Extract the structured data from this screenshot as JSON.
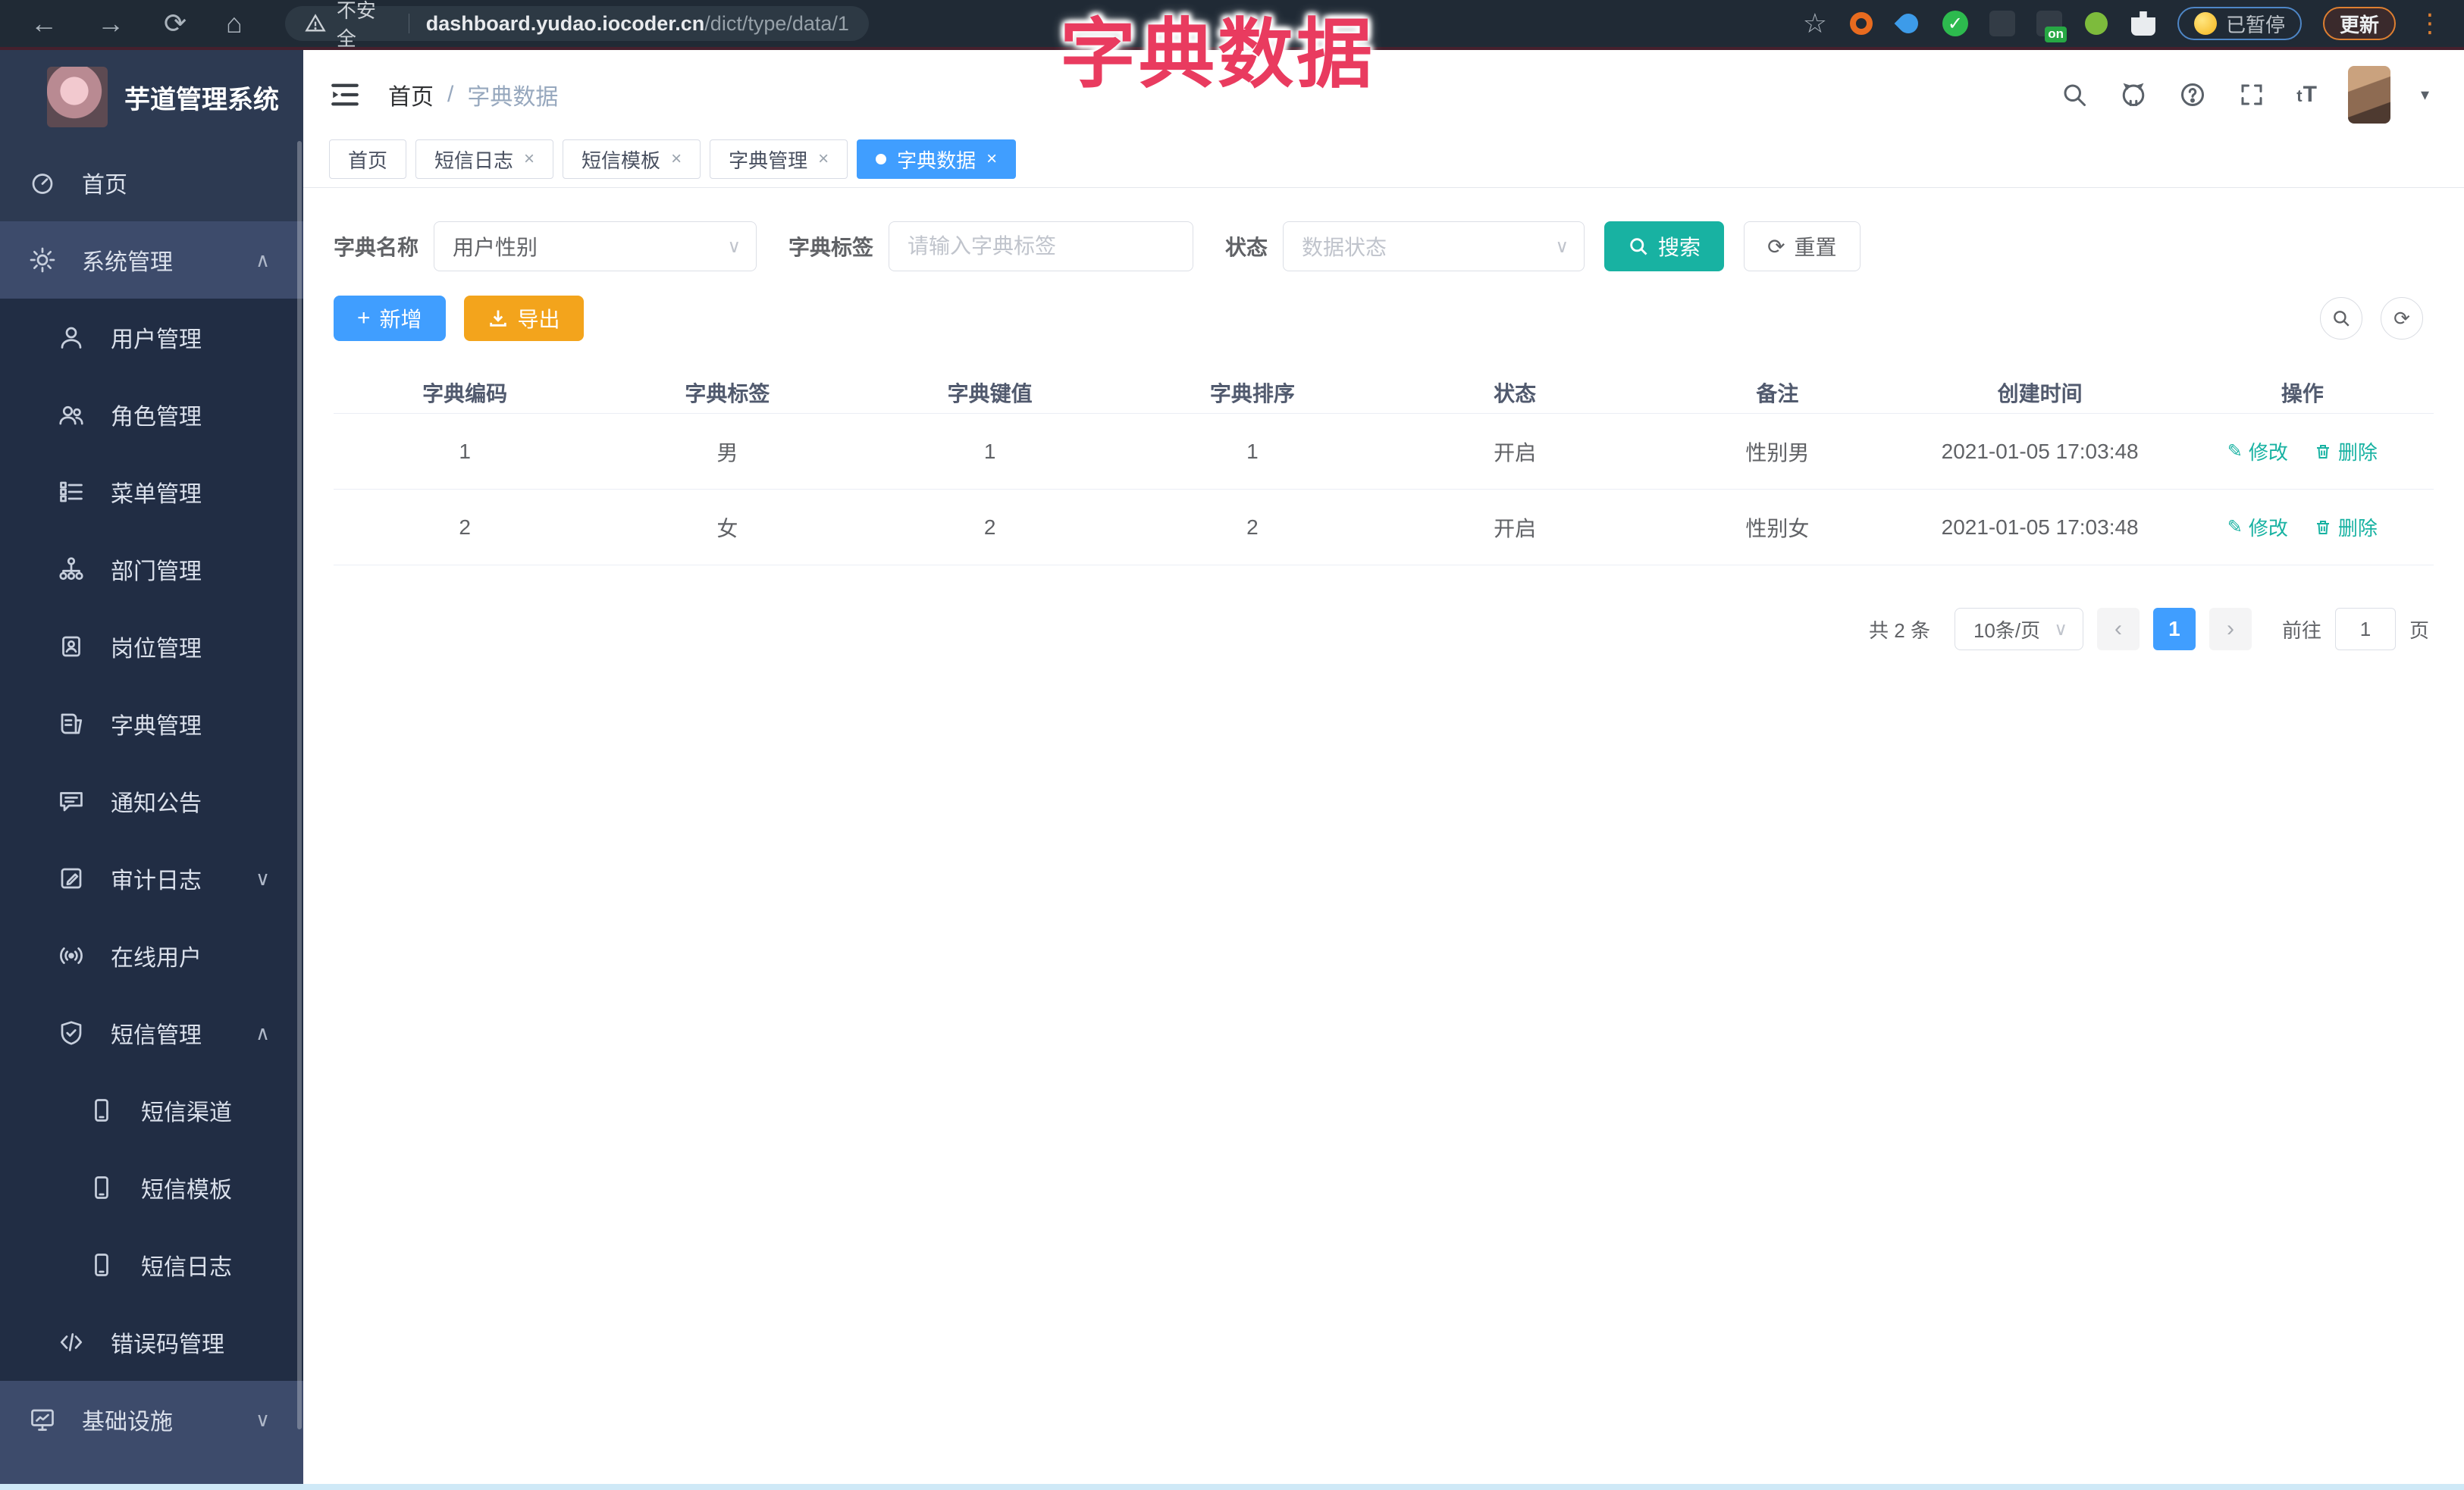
{
  "browser": {
    "security_label": "不安全",
    "url_host": "dashboard.yudao.iocoder.cn",
    "url_path": "/dict/type/data/1",
    "paused_label": "已暂停",
    "update_label": "更新",
    "ext_on_badge": "on"
  },
  "overlay_title": "字典数据",
  "icons": {
    "back": "←",
    "forward": "→",
    "reload": "⟳",
    "home": "⌂",
    "star": "☆",
    "more": "⋮",
    "close": "×",
    "caret_up": "∧",
    "caret_down": "∨",
    "dropdown": "∨",
    "edit": "✎",
    "plus": "+",
    "refresh": "⟳",
    "caret_small": "▾"
  },
  "sidebar": {
    "logo_title": "芋道管理系统",
    "items": [
      {
        "label": "首页"
      },
      {
        "label": "系统管理"
      },
      {
        "label": "用户管理"
      },
      {
        "label": "角色管理"
      },
      {
        "label": "菜单管理"
      },
      {
        "label": "部门管理"
      },
      {
        "label": "岗位管理"
      },
      {
        "label": "字典管理"
      },
      {
        "label": "通知公告"
      },
      {
        "label": "审计日志"
      },
      {
        "label": "在线用户"
      },
      {
        "label": "短信管理"
      },
      {
        "label": "短信渠道"
      },
      {
        "label": "短信模板"
      },
      {
        "label": "短信日志"
      },
      {
        "label": "错误码管理"
      },
      {
        "label": "基础设施"
      }
    ]
  },
  "topbar": {
    "breadcrumb_home": "首页",
    "breadcrumb_sep": "/",
    "breadcrumb_current": "字典数据",
    "font_size_glyph": "tT"
  },
  "tabs": [
    {
      "label": "首页"
    },
    {
      "label": "短信日志"
    },
    {
      "label": "短信模板"
    },
    {
      "label": "字典管理"
    },
    {
      "label": "字典数据"
    }
  ],
  "filters": {
    "name_label": "字典名称",
    "name_value": "用户性别",
    "tag_label": "字典标签",
    "tag_placeholder": "请输入字典标签",
    "status_label": "状态",
    "status_placeholder": "数据状态",
    "search_label": "搜索",
    "reset_label": "重置"
  },
  "toolbar": {
    "add_label": "新增",
    "export_label": "导出"
  },
  "table": {
    "columns": [
      "字典编码",
      "字典标签",
      "字典键值",
      "字典排序",
      "状态",
      "备注",
      "创建时间",
      "操作"
    ],
    "rows": [
      {
        "code": "1",
        "label": "男",
        "value": "1",
        "sort": "1",
        "status": "开启",
        "remark": "性别男",
        "created": "2021-01-05 17:03:48"
      },
      {
        "code": "2",
        "label": "女",
        "value": "2",
        "sort": "2",
        "status": "开启",
        "remark": "性别女",
        "created": "2021-01-05 17:03:48"
      }
    ],
    "edit_label": "修改",
    "delete_label": "删除"
  },
  "pagination": {
    "total_text": "共 2 条",
    "page_size": "10条/页",
    "prev": "‹",
    "current_page": "1",
    "next": "›",
    "goto_label": "前往",
    "goto_value": "1",
    "page_unit": "页"
  },
  "colors": {
    "accent_blue": "#409eff",
    "teal": "#18b2a2",
    "warning_orange": "#f3a41c",
    "title_pink": "#e93b5f",
    "sidebar_bg": "#2d3a52",
    "sidebar_panel_bg": "#212d44",
    "sidebar_subtitle_bg": "#3d4b6b",
    "browser_bar_bg": "#202a35"
  }
}
